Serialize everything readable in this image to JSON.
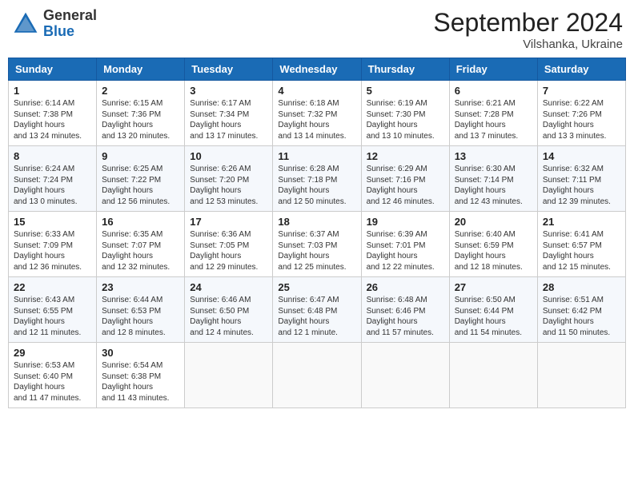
{
  "header": {
    "logo_general": "General",
    "logo_blue": "Blue",
    "month_title": "September 2024",
    "location": "Vilshanka, Ukraine"
  },
  "weekdays": [
    "Sunday",
    "Monday",
    "Tuesday",
    "Wednesday",
    "Thursday",
    "Friday",
    "Saturday"
  ],
  "weeks": [
    [
      {
        "day": "1",
        "sunrise": "6:14 AM",
        "sunset": "7:38 PM",
        "daylight": "13 hours and 24 minutes."
      },
      {
        "day": "2",
        "sunrise": "6:15 AM",
        "sunset": "7:36 PM",
        "daylight": "13 hours and 20 minutes."
      },
      {
        "day": "3",
        "sunrise": "6:17 AM",
        "sunset": "7:34 PM",
        "daylight": "13 hours and 17 minutes."
      },
      {
        "day": "4",
        "sunrise": "6:18 AM",
        "sunset": "7:32 PM",
        "daylight": "13 hours and 14 minutes."
      },
      {
        "day": "5",
        "sunrise": "6:19 AM",
        "sunset": "7:30 PM",
        "daylight": "13 hours and 10 minutes."
      },
      {
        "day": "6",
        "sunrise": "6:21 AM",
        "sunset": "7:28 PM",
        "daylight": "13 hours and 7 minutes."
      },
      {
        "day": "7",
        "sunrise": "6:22 AM",
        "sunset": "7:26 PM",
        "daylight": "13 hours and 3 minutes."
      }
    ],
    [
      {
        "day": "8",
        "sunrise": "6:24 AM",
        "sunset": "7:24 PM",
        "daylight": "13 hours and 0 minutes."
      },
      {
        "day": "9",
        "sunrise": "6:25 AM",
        "sunset": "7:22 PM",
        "daylight": "12 hours and 56 minutes."
      },
      {
        "day": "10",
        "sunrise": "6:26 AM",
        "sunset": "7:20 PM",
        "daylight": "12 hours and 53 minutes."
      },
      {
        "day": "11",
        "sunrise": "6:28 AM",
        "sunset": "7:18 PM",
        "daylight": "12 hours and 50 minutes."
      },
      {
        "day": "12",
        "sunrise": "6:29 AM",
        "sunset": "7:16 PM",
        "daylight": "12 hours and 46 minutes."
      },
      {
        "day": "13",
        "sunrise": "6:30 AM",
        "sunset": "7:14 PM",
        "daylight": "12 hours and 43 minutes."
      },
      {
        "day": "14",
        "sunrise": "6:32 AM",
        "sunset": "7:11 PM",
        "daylight": "12 hours and 39 minutes."
      }
    ],
    [
      {
        "day": "15",
        "sunrise": "6:33 AM",
        "sunset": "7:09 PM",
        "daylight": "12 hours and 36 minutes."
      },
      {
        "day": "16",
        "sunrise": "6:35 AM",
        "sunset": "7:07 PM",
        "daylight": "12 hours and 32 minutes."
      },
      {
        "day": "17",
        "sunrise": "6:36 AM",
        "sunset": "7:05 PM",
        "daylight": "12 hours and 29 minutes."
      },
      {
        "day": "18",
        "sunrise": "6:37 AM",
        "sunset": "7:03 PM",
        "daylight": "12 hours and 25 minutes."
      },
      {
        "day": "19",
        "sunrise": "6:39 AM",
        "sunset": "7:01 PM",
        "daylight": "12 hours and 22 minutes."
      },
      {
        "day": "20",
        "sunrise": "6:40 AM",
        "sunset": "6:59 PM",
        "daylight": "12 hours and 18 minutes."
      },
      {
        "day": "21",
        "sunrise": "6:41 AM",
        "sunset": "6:57 PM",
        "daylight": "12 hours and 15 minutes."
      }
    ],
    [
      {
        "day": "22",
        "sunrise": "6:43 AM",
        "sunset": "6:55 PM",
        "daylight": "12 hours and 11 minutes."
      },
      {
        "day": "23",
        "sunrise": "6:44 AM",
        "sunset": "6:53 PM",
        "daylight": "12 hours and 8 minutes."
      },
      {
        "day": "24",
        "sunrise": "6:46 AM",
        "sunset": "6:50 PM",
        "daylight": "12 hours and 4 minutes."
      },
      {
        "day": "25",
        "sunrise": "6:47 AM",
        "sunset": "6:48 PM",
        "daylight": "12 hours and 1 minute."
      },
      {
        "day": "26",
        "sunrise": "6:48 AM",
        "sunset": "6:46 PM",
        "daylight": "11 hours and 57 minutes."
      },
      {
        "day": "27",
        "sunrise": "6:50 AM",
        "sunset": "6:44 PM",
        "daylight": "11 hours and 54 minutes."
      },
      {
        "day": "28",
        "sunrise": "6:51 AM",
        "sunset": "6:42 PM",
        "daylight": "11 hours and 50 minutes."
      }
    ],
    [
      {
        "day": "29",
        "sunrise": "6:53 AM",
        "sunset": "6:40 PM",
        "daylight": "11 hours and 47 minutes."
      },
      {
        "day": "30",
        "sunrise": "6:54 AM",
        "sunset": "6:38 PM",
        "daylight": "11 hours and 43 minutes."
      },
      null,
      null,
      null,
      null,
      null
    ]
  ]
}
